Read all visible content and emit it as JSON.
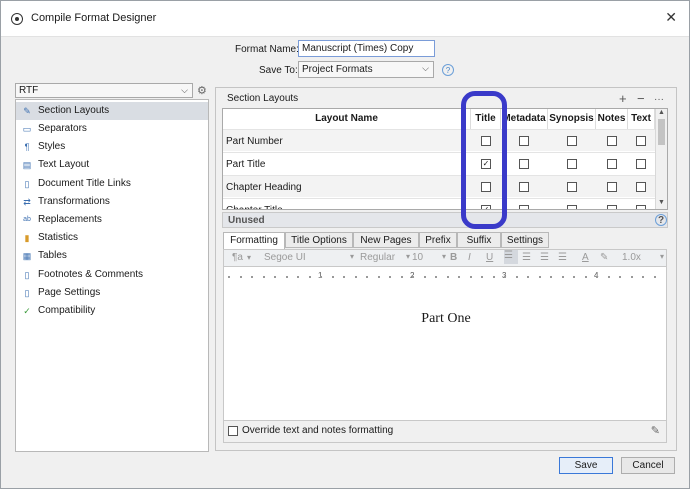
{
  "window": {
    "title": "Compile Format Designer"
  },
  "form": {
    "format_name_label": "Format Name:",
    "format_name_value": "Manuscript (Times) Copy",
    "save_to_label": "Save To:",
    "save_to_value": "Project Formats",
    "help_symbol": "?"
  },
  "left": {
    "format_select": "RTF",
    "items": [
      {
        "label": "Section Layouts",
        "icon": "pencil-icon",
        "glyph": "✎"
      },
      {
        "label": "Separators",
        "icon": "separator-icon",
        "glyph": "▭"
      },
      {
        "label": "Styles",
        "icon": "styles-icon",
        "glyph": "¶"
      },
      {
        "label": "Text Layout",
        "icon": "text-layout-icon",
        "glyph": "▤"
      },
      {
        "label": "Document Title Links",
        "icon": "document-icon",
        "glyph": "▯"
      },
      {
        "label": "Transformations",
        "icon": "transform-icon",
        "glyph": "⇄"
      },
      {
        "label": "Replacements",
        "icon": "replace-icon",
        "glyph": "ab"
      },
      {
        "label": "Statistics",
        "icon": "statistics-icon",
        "glyph": "▮"
      },
      {
        "label": "Tables",
        "icon": "table-icon",
        "glyph": "▦"
      },
      {
        "label": "Footnotes & Comments",
        "icon": "footnote-icon",
        "glyph": "▯"
      },
      {
        "label": "Page Settings",
        "icon": "page-settings-icon",
        "glyph": "▯"
      },
      {
        "label": "Compatibility",
        "icon": "compatibility-icon",
        "glyph": "✓"
      }
    ]
  },
  "section_layouts": {
    "title": "Section Layouts",
    "plus": "+",
    "minus": "−",
    "more": "···",
    "columns": [
      "Layout Name",
      "Title",
      "Metadata",
      "Synopsis",
      "Notes",
      "Text"
    ],
    "rows": [
      {
        "name": "Part Number",
        "checks": [
          false,
          false,
          false,
          false,
          false
        ]
      },
      {
        "name": "Part Title",
        "checks": [
          true,
          false,
          false,
          false,
          false
        ]
      },
      {
        "name": "Chapter Heading",
        "checks": [
          false,
          false,
          false,
          false,
          false
        ]
      },
      {
        "name": "Chapter Title",
        "checks": [
          true,
          false,
          false,
          false,
          false
        ]
      }
    ],
    "unused_label": "Unused"
  },
  "tabs": [
    "Formatting",
    "Title Options",
    "New Pages",
    "Prefix",
    "Suffix",
    "Settings"
  ],
  "toolbar": {
    "para_style": "¶a",
    "font": "Segoe UI",
    "weight": "Regular",
    "size": "10",
    "bold": "B",
    "italic": "I",
    "underline": "U",
    "text_color": "A",
    "line_spacing": "1.0x"
  },
  "ruler": [
    "1",
    "2",
    "3",
    "4"
  ],
  "editor": {
    "sample_text": "Part One"
  },
  "override_label": "Override text and notes formatting",
  "buttons": {
    "save": "Save",
    "cancel": "Cancel"
  },
  "check_mark": "✓"
}
